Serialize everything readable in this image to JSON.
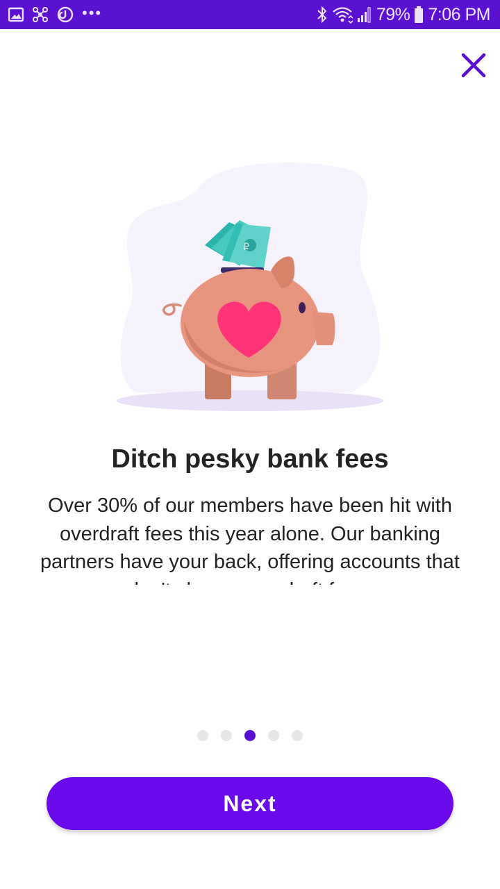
{
  "status_bar": {
    "battery_percent": "79%",
    "time": "7:06 PM",
    "more_indicator": "•••",
    "background_color": "#5b12d0",
    "icons": [
      "image-icon",
      "network-icon",
      "sync-icon",
      "bluetooth-icon",
      "wifi-icon",
      "signal-icon",
      "battery-icon"
    ]
  },
  "onboarding": {
    "title": "Ditch pesky bank fees",
    "body": "Over 30% of our members have been hit with overdraft fees this year alone. Our banking partners have your back, offering accounts that don't charge overdraft fees.",
    "illustration": "piggy-bank-with-heart-and-cash",
    "pager": {
      "total": 5,
      "current": 3
    },
    "next_label": "Next",
    "accent_color": "#6a0aeb",
    "close_icon": "close-icon"
  }
}
